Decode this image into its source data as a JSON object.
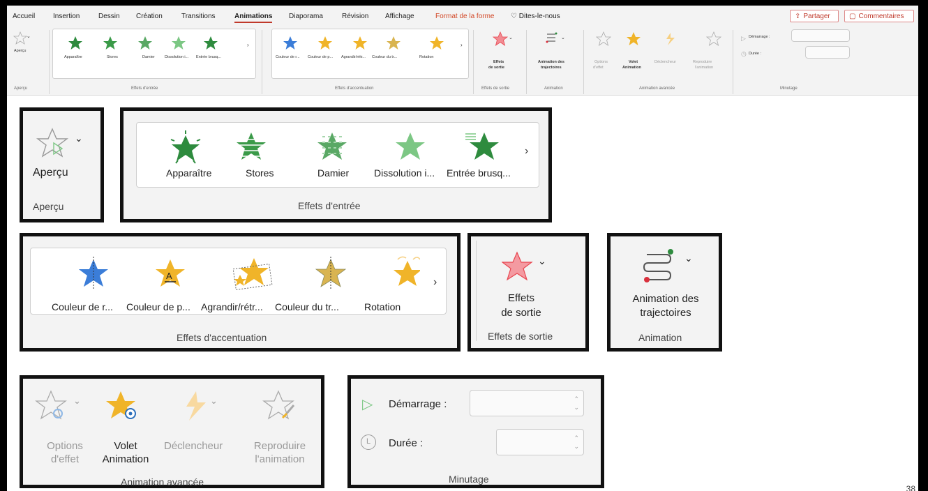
{
  "tabs": [
    "Accueil",
    "Insertion",
    "Dessin",
    "Création",
    "Transitions",
    "Animations",
    "Diaporama",
    "Révision",
    "Affichage",
    "Format de la forme",
    "Dites-le-nous"
  ],
  "top_buttons": {
    "share": "Partager",
    "comments": "Commentaires"
  },
  "ribbon": {
    "preview_label": "Aperçu",
    "preview_group": "Aperçu",
    "entry_items": [
      "Apparaître",
      "Stores",
      "Damier",
      "Dissolution i...",
      "Entrée brusq..."
    ],
    "entry_group": "Effets d'entrée",
    "emphasis_items": [
      "Couleur de r...",
      "Couleur de p...",
      "Agrandir/rétr...",
      "Couleur du tr...",
      "Rotation"
    ],
    "emphasis_group": "Effets d'accentuation",
    "exit_label_1": "Effets",
    "exit_label_2": "de sortie",
    "exit_group": "Effets de sortie",
    "path_label_1": "Animation des",
    "path_label_2": "trajectoires",
    "path_group": "Animation",
    "adv_options_1": "Options",
    "adv_options_2": "d'effet",
    "adv_pane_1": "Volet",
    "adv_pane_2": "Animation",
    "adv_trigger": "Déclencheur",
    "adv_painter_1": "Reproduire",
    "adv_painter_2": "l'animation",
    "adv_group": "Animation avancée",
    "timing_start": "Démarrage :",
    "timing_duration": "Durée :",
    "timing_group": "Minutage"
  },
  "zoom": {
    "preview_label": "Aperçu",
    "preview_group": "Aperçu",
    "entry_items": [
      "Apparaître",
      "Stores",
      "Damier",
      "Dissolution i...",
      "Entrée brusq..."
    ],
    "entry_group": "Effets d'entrée",
    "emphasis_items": [
      "Couleur de r...",
      "Couleur de p...",
      "Agrandir/rétr...",
      "Couleur du tr...",
      "Rotation"
    ],
    "emphasis_group": "Effets d'accentuation",
    "exit_label_1": "Effets",
    "exit_label_2": "de sortie",
    "exit_group": "Effets de sortie",
    "path_label_1": "Animation des",
    "path_label_2": "trajectoires",
    "path_group": "Animation",
    "adv_options_1": "Options",
    "adv_options_2": "d'effet",
    "adv_pane_1": "Volet",
    "adv_pane_2": "Animation",
    "adv_trigger": "Déclencheur",
    "adv_painter_1": "Reproduire",
    "adv_painter_2": "l'animation",
    "adv_group": "Animation avancée",
    "timing_start": "Démarrage :",
    "timing_duration": "Durée :",
    "timing_group": "Minutage"
  },
  "page_number": "38",
  "colors": {
    "accent": "#c0392b",
    "entry_green": "#2e8b3e",
    "emphasis_gold": "#f0b429",
    "exit_red": "#e8454f",
    "bg": "#f3f3f3"
  }
}
